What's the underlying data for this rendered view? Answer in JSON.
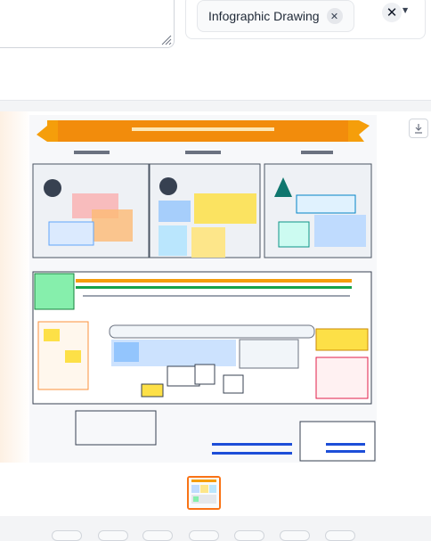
{
  "dropdown": {
    "selected_chip": "Infographic Drawing",
    "chip_remove_icon": "close-icon",
    "clear_icon": "close-icon",
    "caret_icon": "chevron-down-icon"
  },
  "gallery": {
    "download_icon": "download-icon",
    "thumbnail_count": 1
  },
  "colors": {
    "accent": "#f97316",
    "banner": "#f59e0b"
  }
}
